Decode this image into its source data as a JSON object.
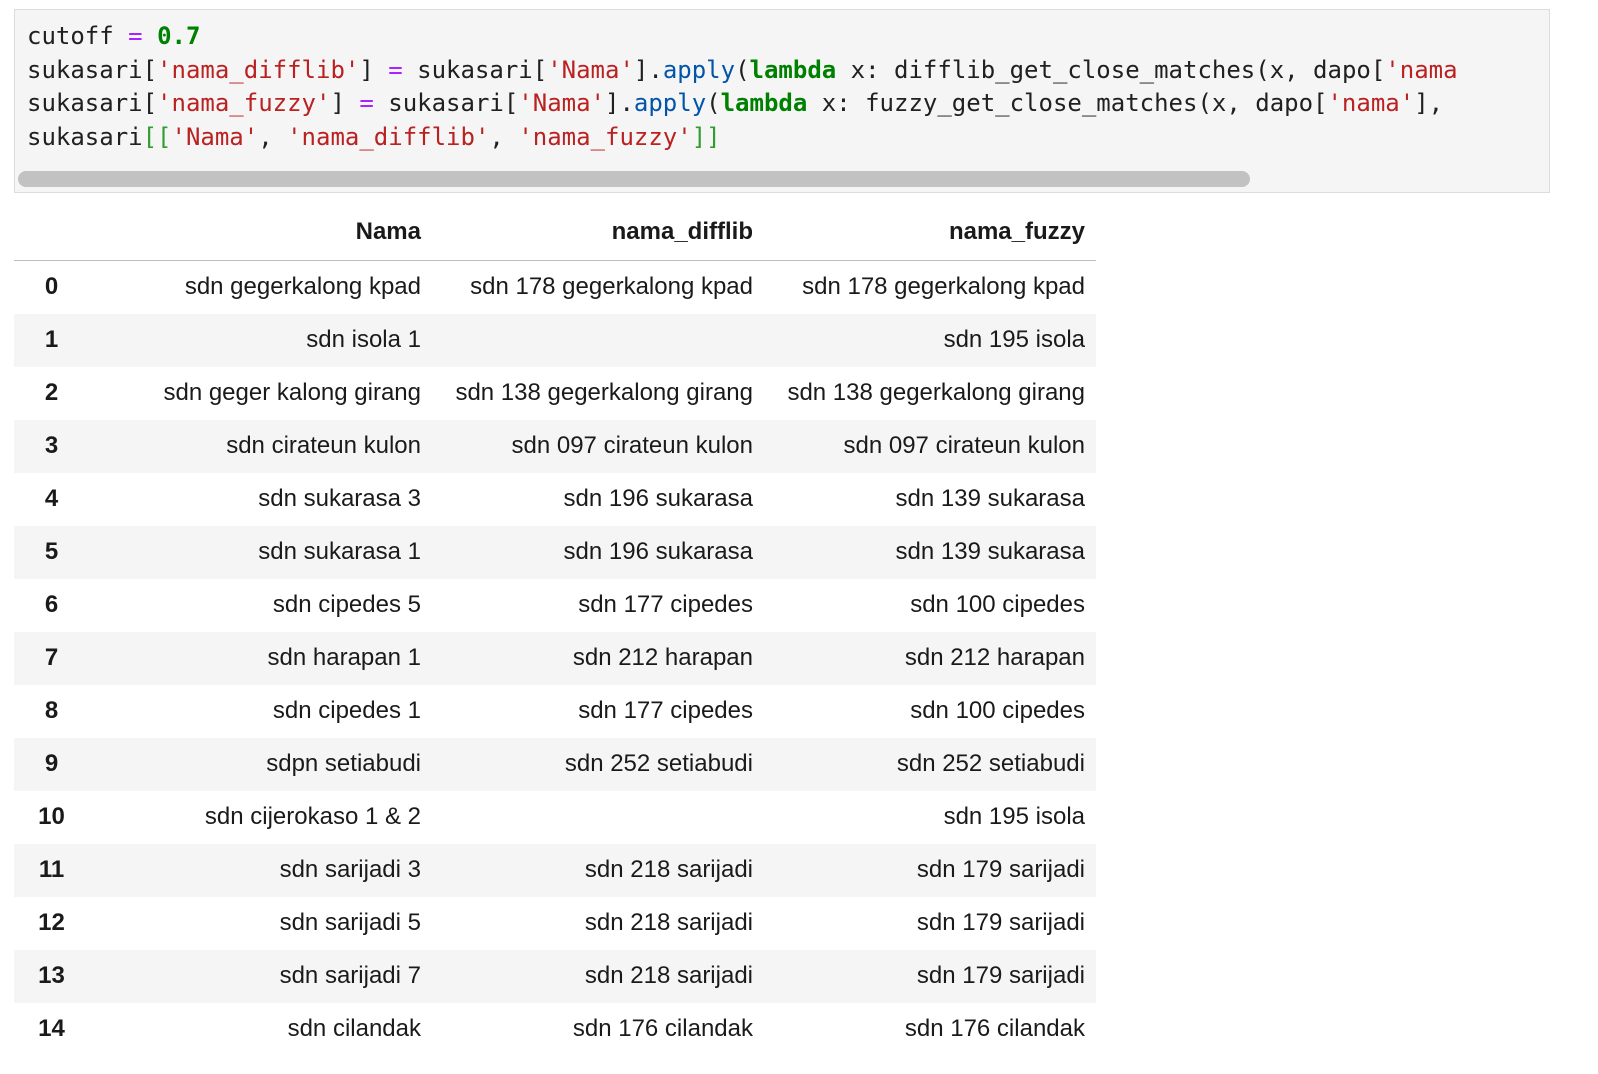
{
  "code_lines": [
    [
      {
        "t": "cutoff ",
        "c": "pl"
      },
      {
        "t": "=",
        "c": "op"
      },
      {
        "t": " ",
        "c": "pl"
      },
      {
        "t": "0.7",
        "c": "num"
      }
    ],
    [
      {
        "t": "sukasari[",
        "c": "pl"
      },
      {
        "t": "'nama_difflib'",
        "c": "str"
      },
      {
        "t": "] ",
        "c": "pl"
      },
      {
        "t": "=",
        "c": "op"
      },
      {
        "t": " sukasari[",
        "c": "pl"
      },
      {
        "t": "'Nama'",
        "c": "str"
      },
      {
        "t": "].",
        "c": "pl"
      },
      {
        "t": "apply",
        "c": "fn"
      },
      {
        "t": "(",
        "c": "pl"
      },
      {
        "t": "lambda",
        "c": "kw"
      },
      {
        "t": " x: difflib_get_close_matches(x, dapo[",
        "c": "pl"
      },
      {
        "t": "'nama",
        "c": "str"
      }
    ],
    [
      {
        "t": "sukasari[",
        "c": "pl"
      },
      {
        "t": "'nama_fuzzy'",
        "c": "str"
      },
      {
        "t": "] ",
        "c": "pl"
      },
      {
        "t": "=",
        "c": "op"
      },
      {
        "t": " sukasari[",
        "c": "pl"
      },
      {
        "t": "'Nama'",
        "c": "str"
      },
      {
        "t": "].",
        "c": "pl"
      },
      {
        "t": "apply",
        "c": "fn"
      },
      {
        "t": "(",
        "c": "pl"
      },
      {
        "t": "lambda",
        "c": "kw"
      },
      {
        "t": " x: fuzzy_get_close_matches(x, dapo[",
        "c": "pl"
      },
      {
        "t": "'nama'",
        "c": "str"
      },
      {
        "t": "], ",
        "c": "pl"
      }
    ],
    [
      {
        "t": "sukasari",
        "c": "pl"
      },
      {
        "t": "[[",
        "c": "br"
      },
      {
        "t": "'Nama'",
        "c": "str"
      },
      {
        "t": ", ",
        "c": "pl"
      },
      {
        "t": "'nama_difflib'",
        "c": "str"
      },
      {
        "t": ", ",
        "c": "pl"
      },
      {
        "t": "'nama_fuzzy'",
        "c": "str"
      },
      {
        "t": "]]",
        "c": "br"
      }
    ]
  ],
  "table": {
    "index_header": "",
    "columns": [
      "Nama",
      "nama_difflib",
      "nama_fuzzy"
    ],
    "rows": [
      {
        "index": "0",
        "nama": "sdn gegerkalong kpad",
        "difflib": "sdn 178 gegerkalong kpad",
        "fuzzy": "sdn 178 gegerkalong kpad"
      },
      {
        "index": "1",
        "nama": "sdn isola 1",
        "difflib": "",
        "fuzzy": "sdn 195 isola"
      },
      {
        "index": "2",
        "nama": "sdn geger kalong girang",
        "difflib": "sdn 138 gegerkalong girang",
        "fuzzy": "sdn 138 gegerkalong girang"
      },
      {
        "index": "3",
        "nama": "sdn cirateun kulon",
        "difflib": "sdn 097 cirateun kulon",
        "fuzzy": "sdn 097 cirateun kulon"
      },
      {
        "index": "4",
        "nama": "sdn sukarasa 3",
        "difflib": "sdn 196 sukarasa",
        "fuzzy": "sdn 139 sukarasa"
      },
      {
        "index": "5",
        "nama": "sdn sukarasa 1",
        "difflib": "sdn 196 sukarasa",
        "fuzzy": "sdn 139 sukarasa"
      },
      {
        "index": "6",
        "nama": "sdn cipedes 5",
        "difflib": "sdn 177 cipedes",
        "fuzzy": "sdn 100 cipedes"
      },
      {
        "index": "7",
        "nama": "sdn harapan 1",
        "difflib": "sdn 212 harapan",
        "fuzzy": "sdn 212 harapan"
      },
      {
        "index": "8",
        "nama": "sdn cipedes 1",
        "difflib": "sdn 177 cipedes",
        "fuzzy": "sdn 100 cipedes"
      },
      {
        "index": "9",
        "nama": "sdpn setiabudi",
        "difflib": "sdn 252 setiabudi",
        "fuzzy": "sdn 252 setiabudi"
      },
      {
        "index": "10",
        "nama": "sdn cijerokaso 1 & 2",
        "difflib": "",
        "fuzzy": "sdn 195 isola"
      },
      {
        "index": "11",
        "nama": "sdn sarijadi 3",
        "difflib": "sdn 218 sarijadi",
        "fuzzy": "sdn 179 sarijadi"
      },
      {
        "index": "12",
        "nama": "sdn sarijadi 5",
        "difflib": "sdn 218 sarijadi",
        "fuzzy": "sdn 179 sarijadi"
      },
      {
        "index": "13",
        "nama": "sdn sarijadi 7",
        "difflib": "sdn 218 sarijadi",
        "fuzzy": "sdn 179 sarijadi"
      },
      {
        "index": "14",
        "nama": "sdn cilandak",
        "difflib": "sdn 176 cilandak",
        "fuzzy": "sdn 176 cilandak"
      }
    ]
  },
  "colors": {
    "cell_background": "#f5f5f5",
    "operator": "#aa22ff",
    "number": "#008000",
    "string": "#ba2121",
    "keyword": "#008000",
    "builtin_method": "#0055aa",
    "bracket": "#2f9e2f",
    "scroll_thumb": "#c2c2c2",
    "row_stripe": "#f5f5f5"
  }
}
